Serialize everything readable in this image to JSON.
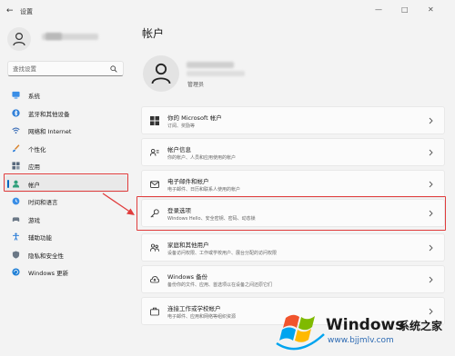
{
  "window": {
    "back_glyph": "←",
    "title": "设置",
    "controls": [
      "—",
      "□",
      "✕"
    ]
  },
  "search": {
    "placeholder": "查找设置"
  },
  "sidebar": {
    "items": [
      {
        "label": "系统",
        "icon": "monitor-icon",
        "active": false
      },
      {
        "label": "蓝牙和其他设备",
        "icon": "bluetooth-icon",
        "active": false
      },
      {
        "label": "网络和 Internet",
        "icon": "wifi-icon",
        "active": false
      },
      {
        "label": "个性化",
        "icon": "brush-icon",
        "active": false
      },
      {
        "label": "应用",
        "icon": "apps-icon",
        "active": false
      },
      {
        "label": "帐户",
        "icon": "account-icon",
        "active": true
      },
      {
        "label": "时间和语言",
        "icon": "globe-clock-icon",
        "active": false
      },
      {
        "label": "游戏",
        "icon": "gamepad-icon",
        "active": false
      },
      {
        "label": "辅助功能",
        "icon": "accessibility-icon",
        "active": false
      },
      {
        "label": "隐私和安全性",
        "icon": "shield-icon",
        "active": false
      },
      {
        "label": "Windows 更新",
        "icon": "update-icon",
        "active": false
      }
    ]
  },
  "main": {
    "title": "帐户",
    "user_role": "管理员",
    "cards": [
      {
        "title": "你的 Microsoft 帐户",
        "subtitle": "订阅、奖励等",
        "icon": "windows-logo-icon"
      },
      {
        "title": "帐户信息",
        "subtitle": "你的帐户、人员和应用使用的帐户",
        "icon": "person-card-icon"
      },
      {
        "title": "电子邮件和帐户",
        "subtitle": "电子邮件、日历和联系人使用的帐户",
        "icon": "mail-icon"
      },
      {
        "title": "登录选项",
        "subtitle": "Windows Hello、安全密钥、密码、动态锁",
        "icon": "key-icon"
      },
      {
        "title": "家庭和其他用户",
        "subtitle": "设备访问权限、工作或学校用户、展台分配的访问权限",
        "icon": "family-icon"
      },
      {
        "title": "Windows 备份",
        "subtitle": "备份你的文件、应用、首选项以在设备之间还原它们",
        "icon": "backup-icon"
      },
      {
        "title": "连接工作或学校帐户",
        "subtitle": "电子邮件、应用和网络等组织资源",
        "icon": "briefcase-icon"
      }
    ]
  },
  "watermark": {
    "brand": "Windows",
    "suffix": "系统之家",
    "url": "www.bjjmlv.com"
  },
  "colors": {
    "accent": "#0067c0",
    "highlight": "#e03c3c"
  }
}
